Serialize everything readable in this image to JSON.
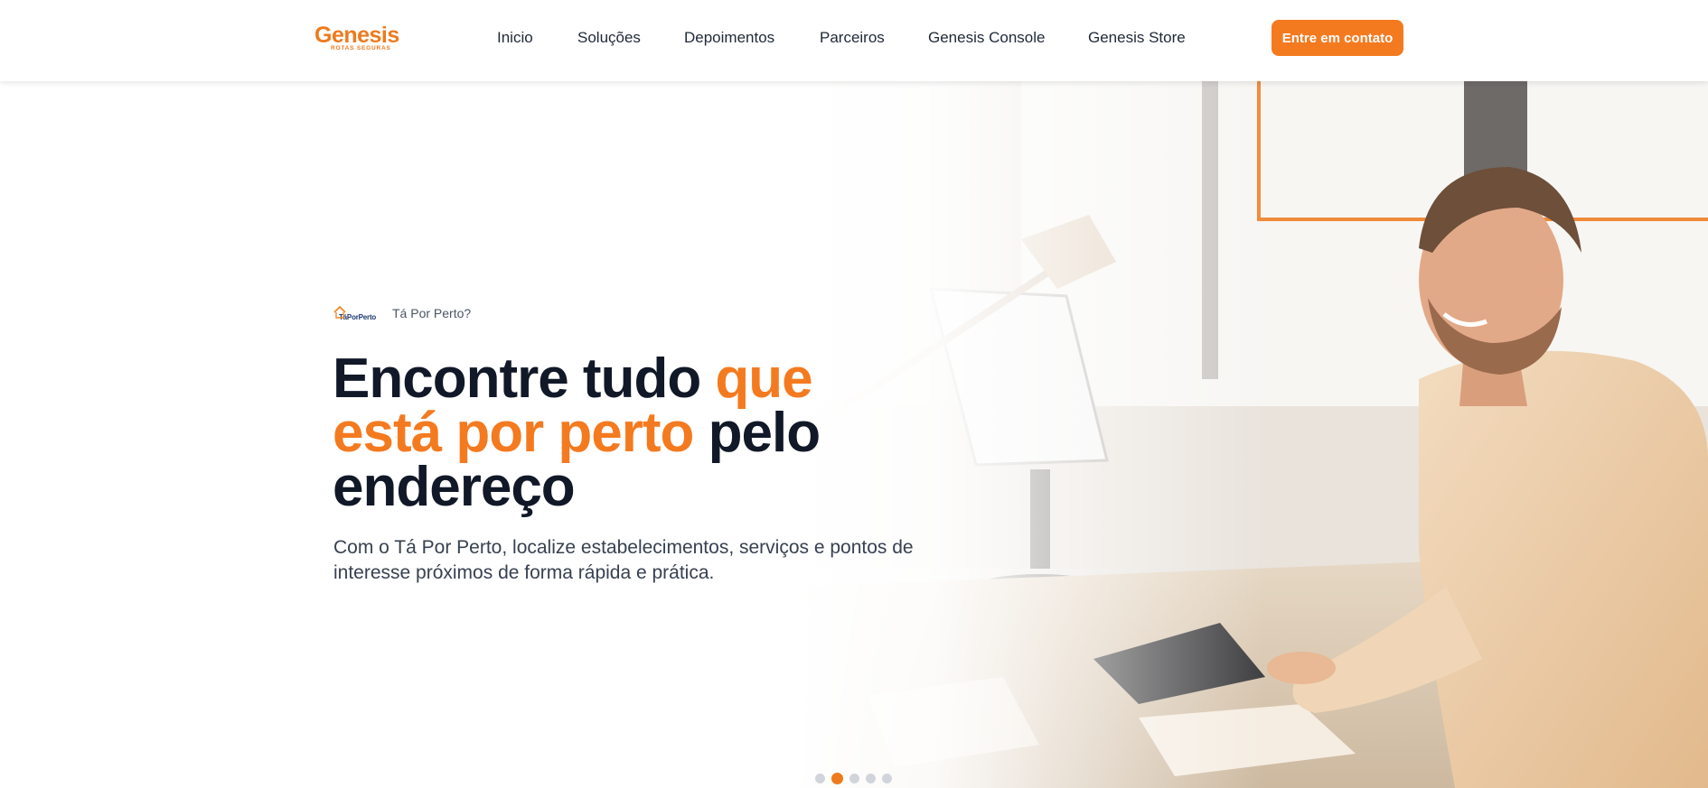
{
  "header": {
    "logo": {
      "name": "Genesis",
      "tagline": "ROTAS SEGURAS"
    },
    "nav": [
      {
        "label": "Inicio"
      },
      {
        "label": "Soluções"
      },
      {
        "label": "Depoimentos"
      },
      {
        "label": "Parceiros"
      },
      {
        "label": "Genesis Console"
      },
      {
        "label": "Genesis Store"
      }
    ],
    "cta_label": "Entre em contato"
  },
  "hero": {
    "brand_logo_text": "TáPorPerto",
    "brand_label": "Tá Por Perto?",
    "headline": {
      "part1": "Encontre tudo ",
      "accent": "que está por perto",
      "part2": " pelo endereço"
    },
    "subtext": "Com o Tá Por Perto, localize estabelecimentos, serviços e pontos de interesse próximos de forma rápida e prática.",
    "carousel": {
      "slides": 5,
      "active_index": 1
    },
    "image_icon": "photo-man-smiling-at-computer"
  },
  "colors": {
    "accent": "#f47a20",
    "headline": "#111827",
    "body_text": "#374151",
    "dot_inactive": "#d1d5db"
  }
}
